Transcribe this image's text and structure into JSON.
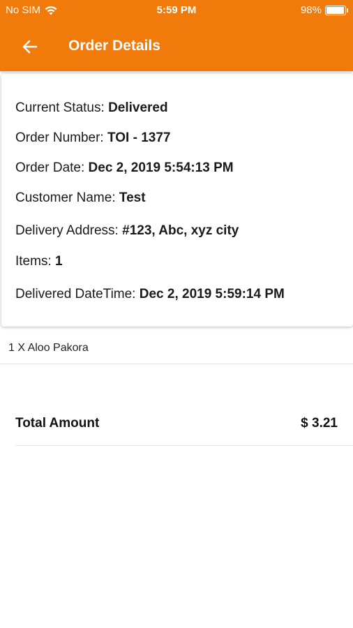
{
  "status_bar": {
    "carrier": "No SIM",
    "time": "5:59 PM",
    "battery_text": "98%",
    "battery_level": 0.98,
    "wifi_icon": "wifi-icon"
  },
  "nav": {
    "back_icon": "back-arrow-icon",
    "title": "Order Details"
  },
  "order": {
    "status": {
      "label": "Current Status: ",
      "value": "Delivered"
    },
    "number": {
      "label": "Order Number: ",
      "value": "TOI - 1377"
    },
    "date": {
      "label": "Order Date: ",
      "value": "Dec 2, 2019 5:54:13 PM"
    },
    "customer": {
      "label": "Customer Name: ",
      "value": "Test"
    },
    "address": {
      "label": "Delivery Address: ",
      "value": "#123, Abc, xyz city"
    },
    "items": {
      "label": "Items: ",
      "value": "1"
    },
    "delivered": {
      "label": "Delivered DateTime: ",
      "value": "Dec 2, 2019 5:59:14 PM"
    }
  },
  "line_items": [
    {
      "text": "1 X Aloo Pakora"
    }
  ],
  "total": {
    "label": "Total Amount",
    "value": "$ 3.21"
  },
  "colors": {
    "accent": "#f07a0a"
  }
}
